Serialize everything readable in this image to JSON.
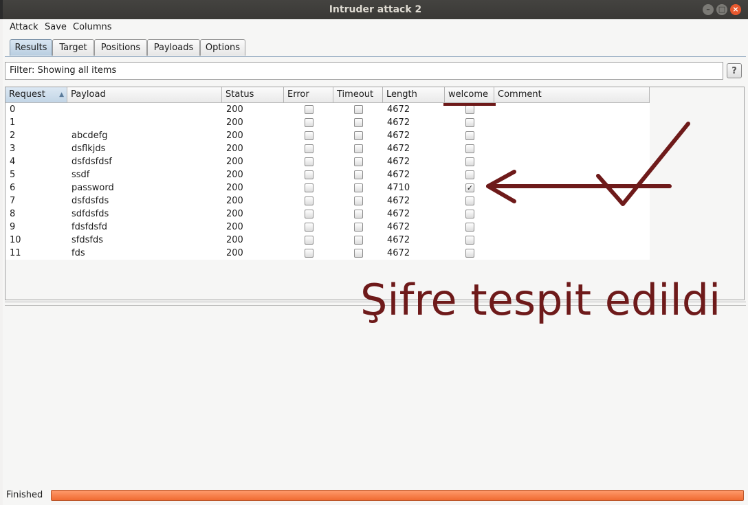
{
  "window": {
    "title": "Intruder attack 2"
  },
  "menu": [
    "Attack",
    "Save",
    "Columns"
  ],
  "tabs": [
    {
      "label": "Results",
      "active": true
    },
    {
      "label": "Target",
      "active": false
    },
    {
      "label": "Positions",
      "active": false
    },
    {
      "label": "Payloads",
      "active": false
    },
    {
      "label": "Options",
      "active": false
    }
  ],
  "filter": {
    "text": "Filter: Showing all items",
    "help": "?"
  },
  "table": {
    "columns": [
      "Request",
      "Payload",
      "Status",
      "Error",
      "Timeout",
      "Length",
      "welcome",
      "Comment"
    ],
    "sorted_column": "Request",
    "rows": [
      {
        "request": "0",
        "payload": "",
        "status": "200",
        "error": false,
        "timeout": false,
        "length": "4672",
        "welcome": false,
        "comment": ""
      },
      {
        "request": "1",
        "payload": "",
        "status": "200",
        "error": false,
        "timeout": false,
        "length": "4672",
        "welcome": false,
        "comment": ""
      },
      {
        "request": "2",
        "payload": "abcdefg",
        "status": "200",
        "error": false,
        "timeout": false,
        "length": "4672",
        "welcome": false,
        "comment": ""
      },
      {
        "request": "3",
        "payload": "dsflkjds",
        "status": "200",
        "error": false,
        "timeout": false,
        "length": "4672",
        "welcome": false,
        "comment": ""
      },
      {
        "request": "4",
        "payload": "dsfdsfdsf",
        "status": "200",
        "error": false,
        "timeout": false,
        "length": "4672",
        "welcome": false,
        "comment": ""
      },
      {
        "request": "5",
        "payload": "ssdf",
        "status": "200",
        "error": false,
        "timeout": false,
        "length": "4672",
        "welcome": false,
        "comment": ""
      },
      {
        "request": "6",
        "payload": "password",
        "status": "200",
        "error": false,
        "timeout": false,
        "length": "4710",
        "welcome": true,
        "comment": ""
      },
      {
        "request": "7",
        "payload": "dsfdsfds",
        "status": "200",
        "error": false,
        "timeout": false,
        "length": "4672",
        "welcome": false,
        "comment": ""
      },
      {
        "request": "8",
        "payload": "sdfdsfds",
        "status": "200",
        "error": false,
        "timeout": false,
        "length": "4672",
        "welcome": false,
        "comment": ""
      },
      {
        "request": "9",
        "payload": "fdsfdsfd",
        "status": "200",
        "error": false,
        "timeout": false,
        "length": "4672",
        "welcome": false,
        "comment": ""
      },
      {
        "request": "10",
        "payload": "sfdsfds",
        "status": "200",
        "error": false,
        "timeout": false,
        "length": "4672",
        "welcome": false,
        "comment": ""
      },
      {
        "request": "11",
        "payload": "fds",
        "status": "200",
        "error": false,
        "timeout": false,
        "length": "4672",
        "welcome": false,
        "comment": ""
      }
    ]
  },
  "status": {
    "label": "Finished",
    "progress_percent": 100
  },
  "annotation": {
    "text": "Şifre tespit edildi",
    "color": "#6e1a1a"
  },
  "colors": {
    "progress": "#f06a32",
    "titlebar": "#3c3b37",
    "annotation": "#6e1a1a"
  }
}
